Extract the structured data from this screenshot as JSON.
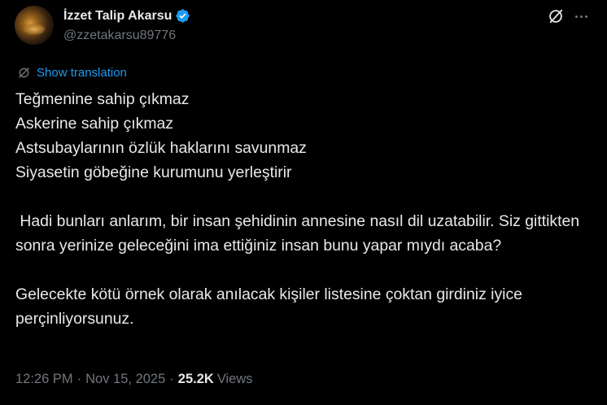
{
  "author": {
    "name": "İzzet Talip Akarsu",
    "handle": "@zzetakarsu89776",
    "verified": true
  },
  "actions": {
    "grok_icon": "grok-icon",
    "more_icon": "more-horizontal-icon"
  },
  "translation_label": "Show translation",
  "tweet_text": "Teğmenine sahip çıkmaz\nAskerine sahip çıkmaz\nAstsubaylarının özlük haklarını savunmaz\nSiyasetin göbeğine kurumunu yerleştirir\n\n Hadi bunları anlarım, bir insan şehidinin annesine nasıl dil uzatabilir. Siz gittikten sonra yerinize geleceğini ima ettiğiniz insan bunu yapar mıydı acaba?\n\nGelecekte kötü örnek olarak anılacak kişiler listesine çoktan girdiniz iyice perçinliyorsunuz.",
  "meta": {
    "time": "12:26 PM",
    "separator": "·",
    "date": "Nov 15, 2025",
    "views_count": "25.2K",
    "views_label": "Views"
  },
  "colors": {
    "background": "#000000",
    "text": "#e7e9ea",
    "secondary": "#71767b",
    "accent": "#1d9bf0"
  }
}
